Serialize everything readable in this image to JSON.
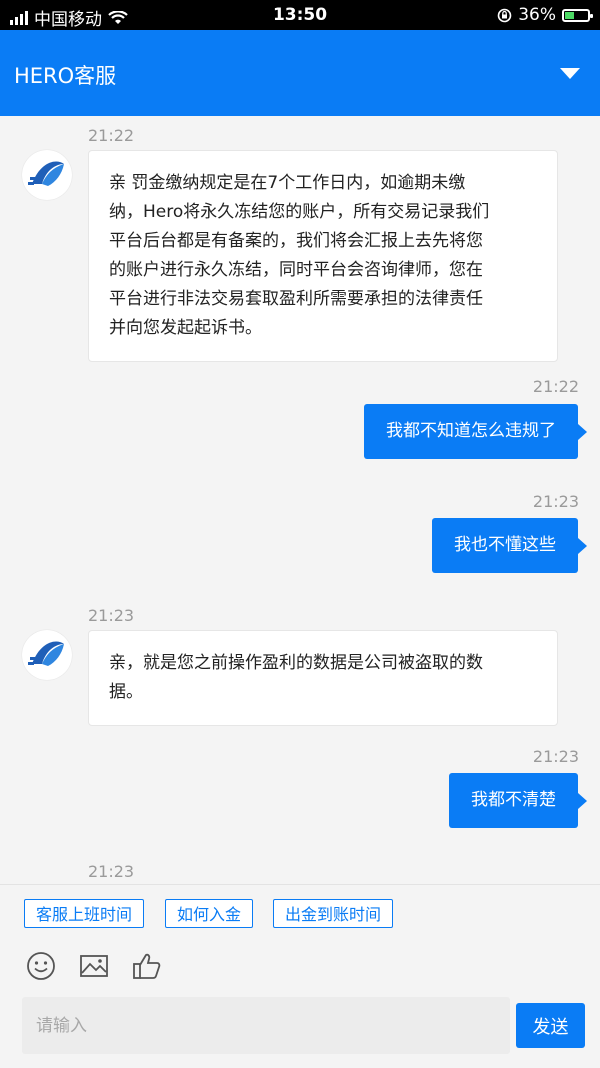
{
  "status_bar": {
    "carrier": "中国移动",
    "time": "13:50",
    "battery": "36%",
    "battery_level": 0.36
  },
  "header": {
    "title": "HERO客服"
  },
  "messages": [
    {
      "timestamp": "21:22",
      "from": "agent",
      "lines": [
        "亲 罚金缴纳规定是在7个工作日内，如逾期未缴",
        "纳，Hero将永久冻结您的账户，所有交易记录我们",
        "平台后台都是有备案的，我们将会汇报上去先将您",
        "的账户进行永久冻结，同时平台会咨询律师，您在",
        "平台进行非法交易套取盈利所需要承担的法律责任",
        "并向您发起起诉书。"
      ]
    },
    {
      "timestamp": "21:22",
      "from": "user",
      "text": "我都不知道怎么违规了"
    },
    {
      "timestamp": "21:23",
      "from": "user",
      "text": "我也不懂这些"
    },
    {
      "timestamp": "21:23",
      "from": "agent",
      "lines": [
        "亲，就是您之前操作盈利的数据是公司被盗取的数",
        "据。"
      ]
    },
    {
      "timestamp": "21:23",
      "from": "user",
      "text": "我都不清楚"
    },
    {
      "timestamp": "21:23",
      "from": "agent"
    }
  ],
  "quick_replies": [
    "客服上班时间",
    "如何入金",
    "出金到账时间"
  ],
  "toolbar": {
    "icons": [
      "emoji-icon",
      "image-icon",
      "thumbs-up-icon"
    ]
  },
  "composer": {
    "placeholder": "请输入",
    "send_label": "发送"
  },
  "colors": {
    "accent": "#0a7cf5",
    "background": "#f4f4f4"
  }
}
